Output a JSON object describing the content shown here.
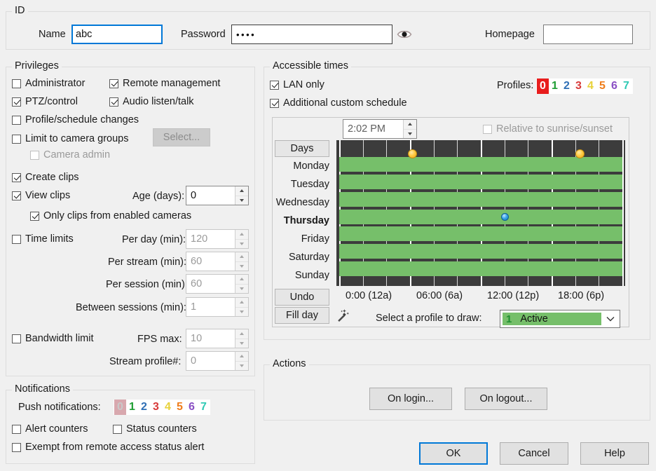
{
  "id_section": {
    "legend": "ID",
    "name_label": "Name",
    "name_value": "abc",
    "password_label": "Password",
    "password_value": "••••",
    "homepage_label": "Homepage",
    "homepage_value": "",
    "reveal_icon": "eye-icon"
  },
  "privileges": {
    "legend": "Privileges",
    "administrator": "Administrator",
    "remote_management": "Remote management",
    "ptz_control": "PTZ/control",
    "audio_listen_talk": "Audio listen/talk",
    "profile_schedule_changes": "Profile/schedule changes",
    "limit_to_camera_groups": "Limit to camera groups",
    "select_button": "Select...",
    "camera_admin": "Camera admin",
    "create_clips": "Create clips",
    "view_clips": "View clips",
    "age_days_label": "Age (days):",
    "age_days_value": "0",
    "only_clips_enabled": "Only clips from enabled cameras",
    "time_limits": "Time limits",
    "per_day_label": "Per day (min):",
    "per_day_value": "120",
    "per_stream_label": "Per stream (min):",
    "per_stream_value": "60",
    "per_session_label": "Per session (min):",
    "per_session_value": "60",
    "between_sessions_label": "Between sessions (min):",
    "between_sessions_value": "1",
    "bandwidth_limit": "Bandwidth limit",
    "fps_max_label": "FPS max:",
    "fps_max_value": "10",
    "stream_profile_label": "Stream profile#:",
    "stream_profile_value": "0"
  },
  "notifications": {
    "legend": "Notifications",
    "push_label": "Push notifications:",
    "digits": [
      "0",
      "1",
      "2",
      "3",
      "4",
      "5",
      "6",
      "7"
    ],
    "digit_colors": [
      "#b9b9b9",
      "#1f9e34",
      "#2f6fb5",
      "#d83a3a",
      "#e8d23a",
      "#ef7d1a",
      "#8a4fc4",
      "#2fc9b4"
    ],
    "selected_digit_index": 0,
    "selected_digit_bg": "#d8a8ae",
    "alert_counters": "Alert counters",
    "status_counters": "Status counters",
    "exempt_remote": "Exempt from remote access status alert"
  },
  "accessible_times": {
    "legend": "Accessible times",
    "lan_only": "LAN only",
    "additional_custom_schedule": "Additional custom schedule",
    "profiles_label": "Profiles:",
    "profile_digits": [
      "0",
      "1",
      "2",
      "3",
      "4",
      "5",
      "6",
      "7"
    ],
    "profile_digit_colors": [
      "#ffffff",
      "#1f9e34",
      "#2f6fb5",
      "#d83a3a",
      "#e8d23a",
      "#ef7d1a",
      "#8a4fc4",
      "#2fc9b4"
    ],
    "selected_profile_index": 0,
    "selected_profile_bg": "#e81d1d",
    "time_value": "2:02 PM",
    "relative_sunrise": "Relative to sunrise/sunset",
    "days_button": "Days",
    "day_rows": [
      "Monday",
      "Tuesday",
      "Wednesday",
      "Thursday",
      "Friday",
      "Saturday",
      "Sunday"
    ],
    "today": "Thursday",
    "axis_labels": [
      "0:00 (12a)",
      "06:00 (6a)",
      "12:00 (12p)",
      "18:00 (6p)"
    ],
    "undo_button": "Undo",
    "fill_day_button": "Fill day",
    "wand_icon": "magic-wand-icon",
    "select_profile_label": "Select a profile to draw:",
    "draw_profile_number": "1",
    "draw_profile_name": "Active",
    "draw_profile_color": "#76bf6a",
    "grid_active_color": "#76bf6a",
    "grid_inactive_color": "#3c3c3c",
    "sunrise_hour": 6.2,
    "sunset_hour": 20.4,
    "now_marker_hour": 14.05
  },
  "actions": {
    "legend": "Actions",
    "on_login": "On login...",
    "on_logout": "On logout..."
  },
  "dialog_buttons": {
    "ok": "OK",
    "cancel": "Cancel",
    "help": "Help"
  }
}
